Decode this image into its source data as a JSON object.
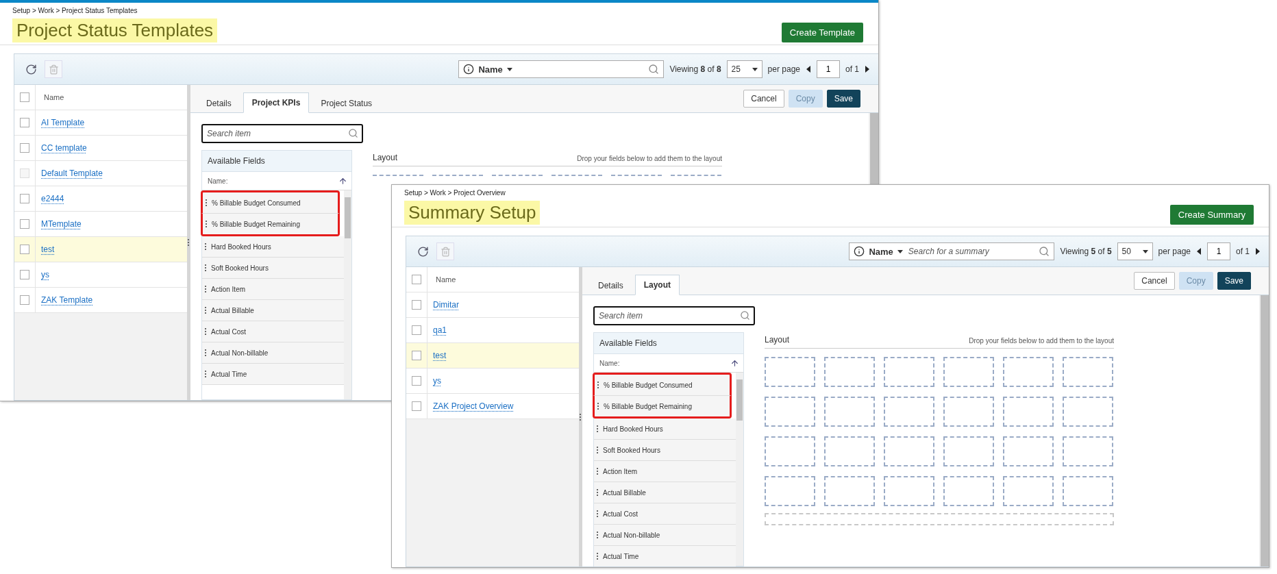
{
  "windows": [
    {
      "top_bar": true,
      "breadcrumb": "Setup > Work > Project Status Templates",
      "title": "Project Status Templates",
      "create_button": "Create Template",
      "search": {
        "filter": "Name"
      },
      "viewing": "Viewing **8** of **8**",
      "per_page": "25",
      "per_page_label": "per page",
      "page": "1",
      "page_total": "of 1",
      "list_header": "Name",
      "all_checked": false,
      "list": [
        {
          "name": "AI Template",
          "selected": false,
          "disabled": false
        },
        {
          "name": "CC template",
          "selected": false,
          "disabled": false
        },
        {
          "name": "Default Template",
          "selected": false,
          "disabled": true
        },
        {
          "name": "e2444",
          "selected": false,
          "disabled": false
        },
        {
          "name": "MTemplate",
          "selected": false,
          "disabled": false
        },
        {
          "name": "test",
          "selected": true,
          "disabled": false
        },
        {
          "name": "ys",
          "selected": false,
          "disabled": false
        },
        {
          "name": "ZAK Template",
          "selected": false,
          "disabled": false
        }
      ],
      "tabs": [
        {
          "label": "Details",
          "selected": false
        },
        {
          "label": "Project KPIs",
          "selected": true
        },
        {
          "label": "Project Status",
          "selected": false
        }
      ],
      "actions": [
        {
          "label": "Cancel",
          "kind": "cancel"
        },
        {
          "label": "Copy",
          "kind": "copy"
        },
        {
          "label": "Save",
          "kind": "save"
        }
      ],
      "field_search": {
        "placeholder": "Search item"
      },
      "fields_title": "Available Fields",
      "fields_sort_label": "Name:",
      "fields": [
        {
          "label": "% Billable Budget Consumed",
          "highlighted": true
        },
        {
          "label": "% Billable Budget Remaining",
          "highlighted": true
        },
        {
          "label": "Hard Booked Hours",
          "highlighted": false
        },
        {
          "label": "Soft Booked Hours",
          "highlighted": false
        },
        {
          "label": "Action Item",
          "highlighted": false
        },
        {
          "label": "Actual Billable",
          "highlighted": false
        },
        {
          "label": "Actual Cost",
          "highlighted": false
        },
        {
          "label": "Actual Non-billable",
          "highlighted": false
        },
        {
          "label": "Actual Time",
          "highlighted": false
        }
      ],
      "layout": {
        "title": "Layout",
        "hint": "Drop your fields below to add them to the layout",
        "kind": "edges"
      }
    },
    {
      "top_bar": false,
      "breadcrumb": "Setup > Work > Project Overview",
      "title": "Summary Setup",
      "create_button": "Create Summary",
      "search": {
        "filter": "Name",
        "placeholder": "Search for a summary"
      },
      "viewing": "Viewing **5** of **5**",
      "per_page": "50",
      "per_page_label": "per page",
      "page": "1",
      "page_total": "of 1",
      "list_header": "Name",
      "all_checked": false,
      "list": [
        {
          "name": "Dimitar",
          "selected": false,
          "disabled": false
        },
        {
          "name": "qa1",
          "selected": false,
          "disabled": false
        },
        {
          "name": "test",
          "selected": true,
          "disabled": false
        },
        {
          "name": "ys",
          "selected": false,
          "disabled": false
        },
        {
          "name": "ZAK Project Overview",
          "selected": false,
          "disabled": false
        }
      ],
      "tabs": [
        {
          "label": "Details",
          "selected": false
        },
        {
          "label": "Layout",
          "selected": true
        }
      ],
      "actions": [
        {
          "label": "Cancel",
          "kind": "cancel"
        },
        {
          "label": "Copy",
          "kind": "copy"
        },
        {
          "label": "Save",
          "kind": "save"
        }
      ],
      "field_search": {
        "placeholder": "Search item"
      },
      "fields_title": "Available Fields",
      "fields_sort_label": "Name:",
      "fields": [
        {
          "label": "% Billable Budget Consumed",
          "highlighted": true
        },
        {
          "label": "% Billable Budget Remaining",
          "highlighted": true
        },
        {
          "label": "Hard Booked Hours",
          "highlighted": false
        },
        {
          "label": "Soft Booked Hours",
          "highlighted": false
        },
        {
          "label": "Action Item",
          "highlighted": false
        },
        {
          "label": "Actual Billable",
          "highlighted": false
        },
        {
          "label": "Actual Cost",
          "highlighted": false
        },
        {
          "label": "Actual Non-billable",
          "highlighted": false
        },
        {
          "label": "Actual Time",
          "highlighted": false
        }
      ],
      "layout": {
        "title": "Layout",
        "hint": "Drop your fields below to add them to the layout",
        "kind": "grid"
      }
    }
  ]
}
